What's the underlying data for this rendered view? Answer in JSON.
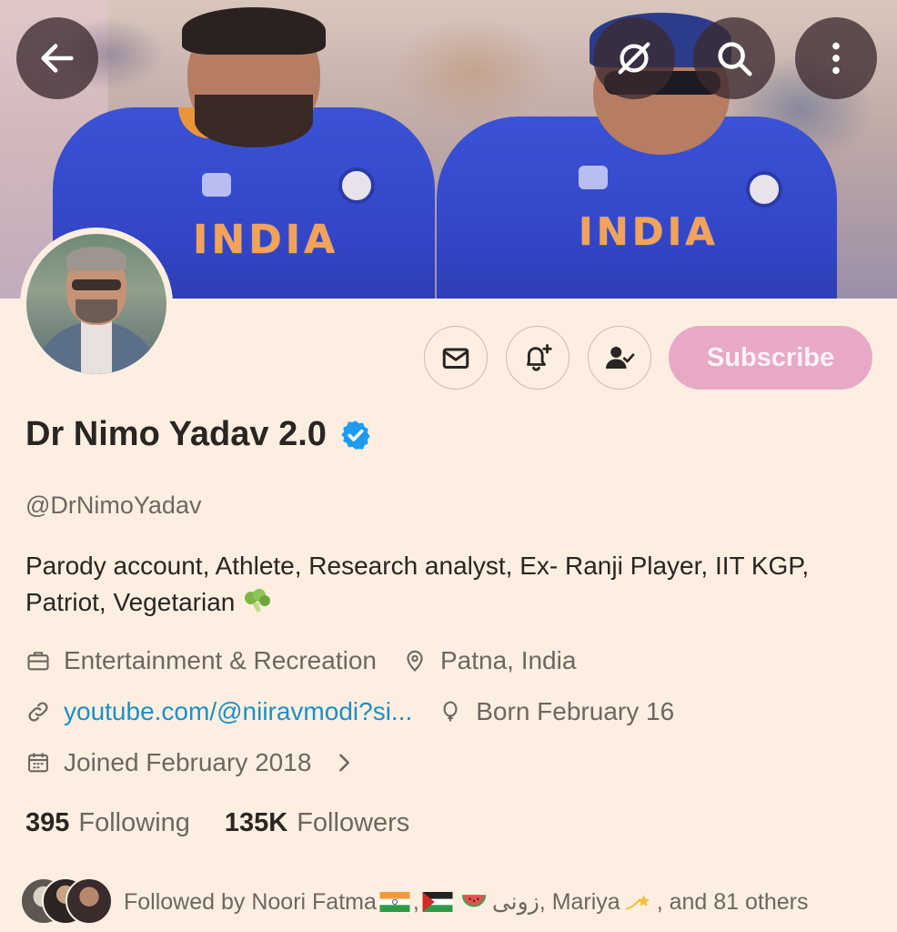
{
  "banner": {
    "jersey_text_left": "INDIA",
    "jersey_text_right": "INDIA",
    "back_icon": "arrow-left-icon",
    "grok_icon": "grok-icon",
    "search_icon": "search-icon",
    "more_icon": "more-vertical-icon"
  },
  "actions": {
    "message_icon": "mail-icon",
    "notify_icon": "bell-plus-icon",
    "follow_icon": "person-check-icon",
    "subscribe_label": "Subscribe"
  },
  "profile": {
    "name": "Dr Nimo Yadav 2.0",
    "verified": true,
    "handle": "@DrNimoYadav",
    "bio": "Parody account, Athlete, Research analyst, Ex- Ranji Player, IIT KGP, Patriot, Vegetarian",
    "bio_emoji": "broccoli",
    "category": "Entertainment & Recreation",
    "location": "Patna, India",
    "website": "youtube.com/@niiravmodi?si...",
    "birthday": "Born February 16",
    "joined": "Joined February 2018"
  },
  "stats": {
    "following_count": "395",
    "following_label": "Following",
    "followers_count": "135K",
    "followers_label": "Followers"
  },
  "followed_by": {
    "prefix": "Followed by Noori Fatma",
    "sep1": ",",
    "name2": "زونی",
    "rest": ", Mariya",
    "tail": ", and 81 others"
  },
  "colors": {
    "background": "#fcefe1",
    "subscribe_bg": "#e8a9c6",
    "link": "#1d8fc4",
    "verified": "#1d9bf0"
  }
}
